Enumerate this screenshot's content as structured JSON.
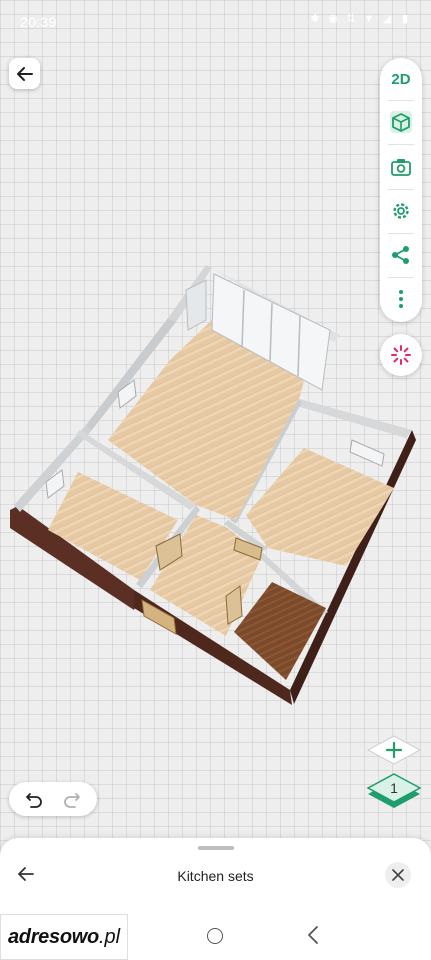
{
  "status": {
    "time": "20:39"
  },
  "toolbar": {
    "mode_2d_label": "2D",
    "items": [
      "3d-view",
      "camera",
      "settings",
      "share",
      "more"
    ]
  },
  "colors": {
    "accent": "#1e9e6a",
    "magic": "#e2266f"
  },
  "floors": {
    "current": "1"
  },
  "panel": {
    "title": "Kitchen sets"
  },
  "watermark": {
    "brand": "adresowo",
    "tld": ".pl"
  }
}
